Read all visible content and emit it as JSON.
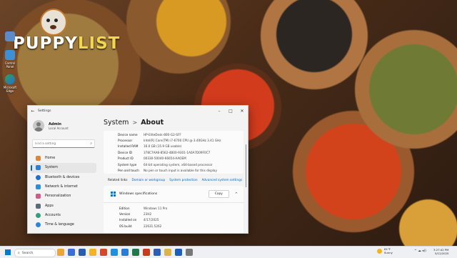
{
  "desktop": {
    "logo": {
      "part1": "PUPPY",
      "part2": "LIST"
    },
    "icons": [
      {
        "label": "",
        "color": "#5b8bc9"
      },
      {
        "label": "Control Panel",
        "color": "#3d8fd6"
      },
      {
        "label": "Microsoft Edge",
        "color": "#2fa25d"
      }
    ]
  },
  "window": {
    "app_title": "Settings",
    "back_icon": "back-arrow-icon",
    "controls": [
      "minimize-icon",
      "maximize-icon",
      "close-icon"
    ]
  },
  "nav": {
    "user_name": "Admin",
    "user_sub": "Local Account",
    "search_placeholder": "Find a setting",
    "items": [
      {
        "label": "Home",
        "icon": "home-icon",
        "color": "#d9883a",
        "active": false
      },
      {
        "label": "System",
        "icon": "system-icon",
        "color": "#2b7fd6",
        "active": true
      },
      {
        "label": "Bluetooth & devices",
        "icon": "bluetooth-icon",
        "color": "#1f6fd1",
        "active": false
      },
      {
        "label": "Network & internet",
        "icon": "network-icon",
        "color": "#2e8fd8",
        "active": false
      },
      {
        "label": "Personalization",
        "icon": "brush-icon",
        "color": "#d05a8a",
        "active": false
      },
      {
        "label": "Apps",
        "icon": "apps-icon",
        "color": "#5a6b7d",
        "active": false
      },
      {
        "label": "Accounts",
        "icon": "accounts-icon",
        "color": "#2fa07a",
        "active": false
      },
      {
        "label": "Time & language",
        "icon": "globe-clock-icon",
        "color": "#2b86d9",
        "active": false
      }
    ]
  },
  "main": {
    "breadcrumb": {
      "parent": "System",
      "separator": ">",
      "current": "About"
    },
    "device_specs": [
      {
        "key": "Device name",
        "value": "HP-EliteDesk-800-G2-SFF"
      },
      {
        "key": "Processor",
        "value": "Intel(R) Core(TM) i7-6700 CPU @ 3.40GHz   3.41 GHz"
      },
      {
        "key": "Installed RAM",
        "value": "16.0 GB (15.9 GB usable)"
      },
      {
        "key": "Device ID",
        "value": "378C7AA8-8562-4B00-9301-1A0A7D09F0C7"
      },
      {
        "key": "Product ID",
        "value": "00330-50040-66654-AAOEM"
      },
      {
        "key": "System type",
        "value": "64-bit operating system, x64-based processor"
      },
      {
        "key": "Pen and touch",
        "value": "No pen or touch input is available for this display"
      }
    ],
    "related_links": {
      "label": "Related links",
      "links": [
        "Domain or workgroup",
        "System protection",
        "Advanced system settings"
      ]
    },
    "windows_specs": {
      "title": "Windows specifications",
      "copy_label": "Copy",
      "rows": [
        {
          "key": "Edition",
          "value": "Windows 11 Pro"
        },
        {
          "key": "Version",
          "value": "23H2"
        },
        {
          "key": "Installed on",
          "value": "4/17/2025"
        },
        {
          "key": "OS build",
          "value": "22631.5262"
        }
      ]
    }
  },
  "taskbar": {
    "search_label": "Search",
    "apps": [
      "#e8a73a",
      "#3a6fd8",
      "#2a5db0",
      "#f0b429",
      "#d04a2a",
      "#1f8fe0",
      "#2d7ad6",
      "#1f7a4a",
      "#c43e1c",
      "#2b5fb3",
      "#d9b54a",
      "#1b5fb8",
      "#777777"
    ],
    "weather_temp": "61°F",
    "weather_desc": "Sunny",
    "tray": "^ ☁ ◂))",
    "time": "3:27:42 PM",
    "date": "5/12/2025"
  }
}
